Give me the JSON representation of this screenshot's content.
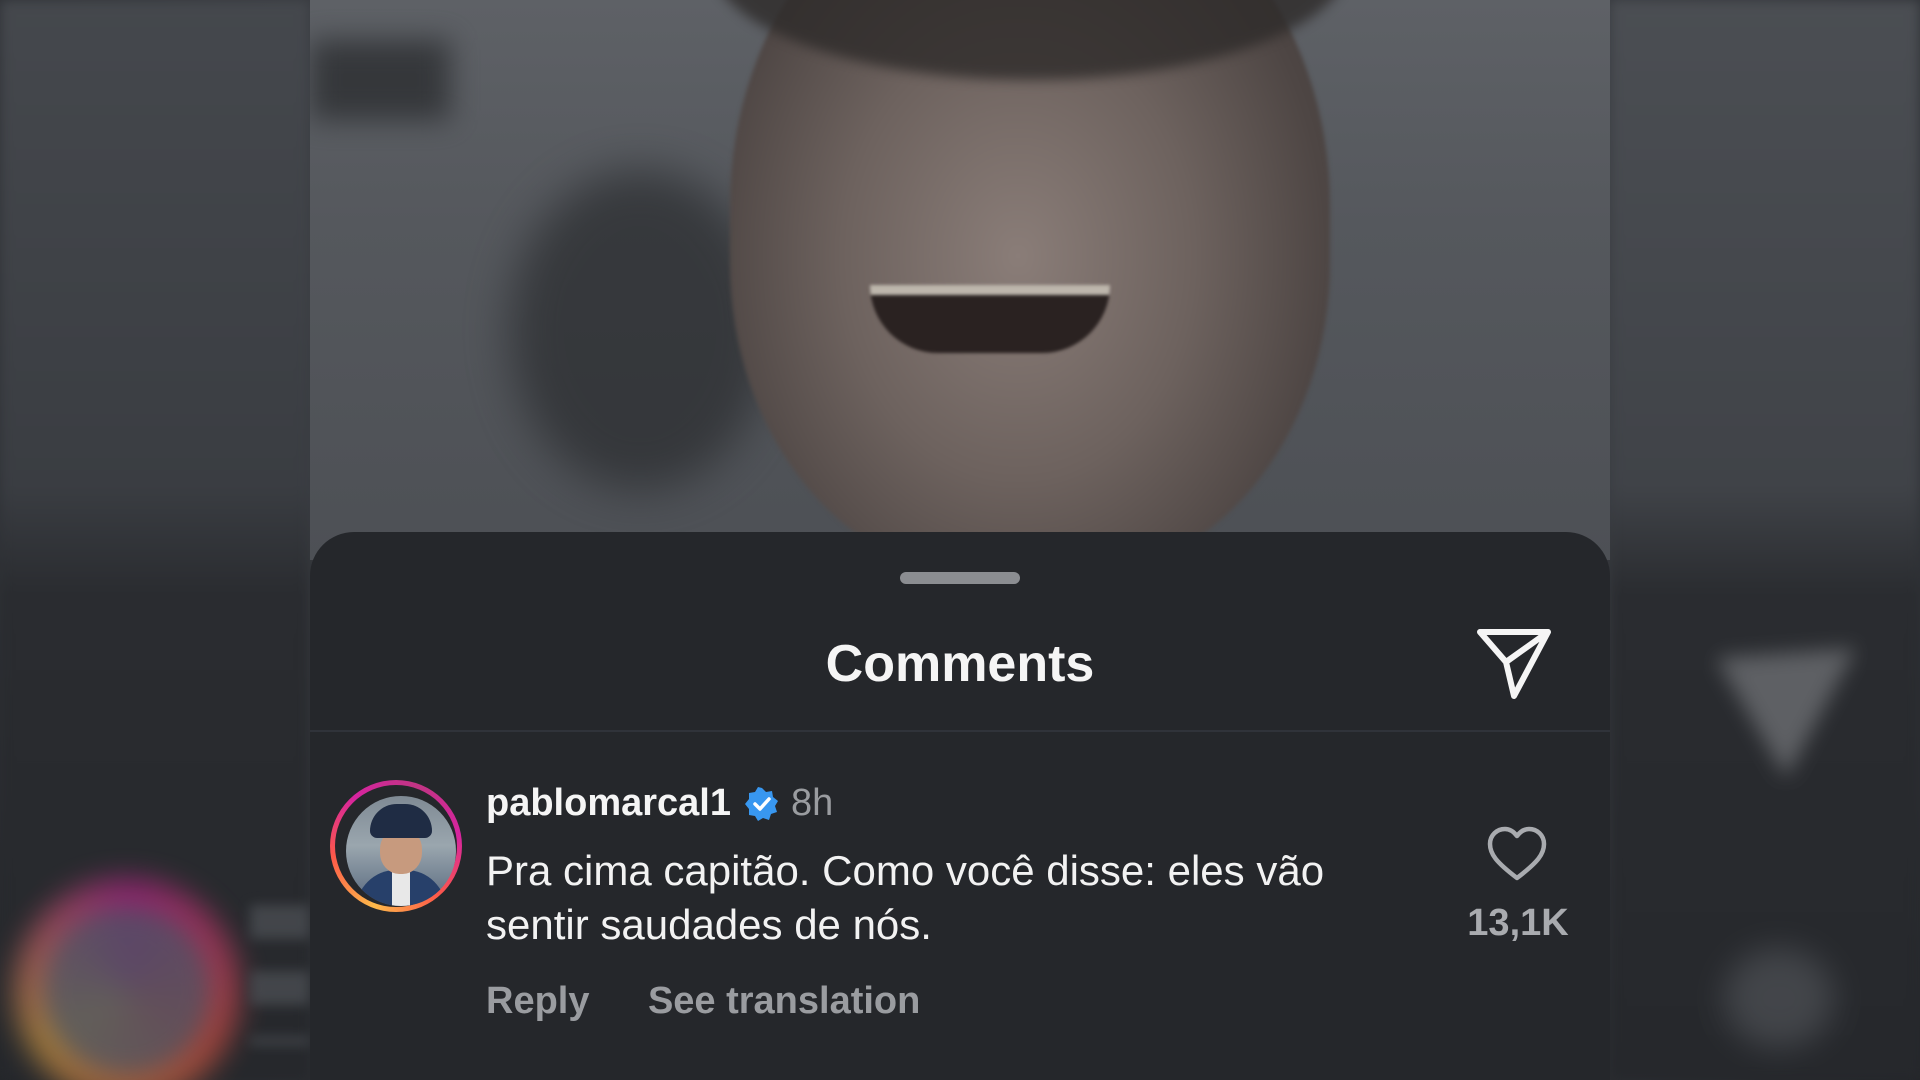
{
  "sheet": {
    "title": "Comments"
  },
  "comment": {
    "username": "pablomarcal1",
    "timestamp": "8h",
    "text": "Pra cima capitão. Como você disse: eles vão sentir saudades de nós.",
    "actions": {
      "reply": "Reply",
      "see_translation": "See translation"
    },
    "like_count": "13,1K",
    "verified": true
  },
  "icons": {
    "send": "paper-plane-icon",
    "like": "heart-icon",
    "verified": "verified-badge-icon"
  },
  "colors": {
    "sheet_bg": "#25272b",
    "verified_blue": "#3897f0",
    "muted_text": "#9a9ca0"
  }
}
